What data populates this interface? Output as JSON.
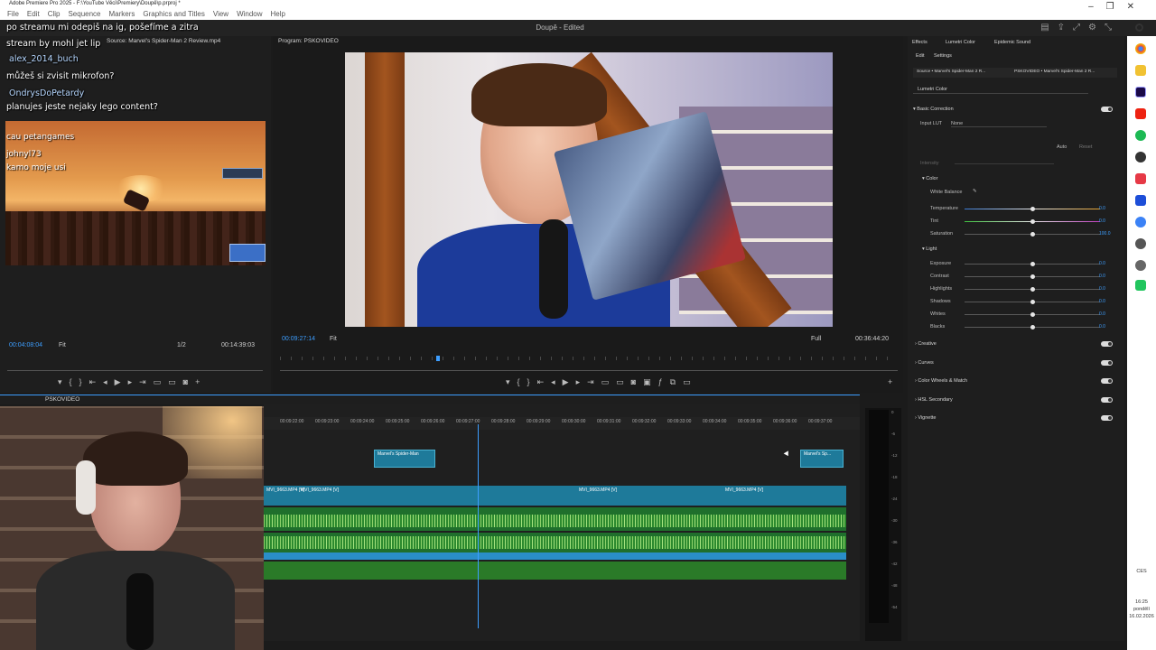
{
  "titlebar": {
    "title": "Adobe Premiere Pro 2025 - F:\\YouTube Věci\\Premiery\\Doupě\\p.prproj *",
    "menus": [
      "File",
      "Edit",
      "Clip",
      "Sequence",
      "Markers",
      "Graphics and Titles",
      "View",
      "Window",
      "Help"
    ]
  },
  "appbar": {
    "document_title": "Doupě - Edited"
  },
  "chat": {
    "messages": [
      {
        "text": "po streamu mi odepiš na ig, pošefíme a zitra"
      },
      {
        "text": "stream by mohl jet lip"
      },
      {
        "user": "alex_2014_buch",
        "text": "můžeš si zvisit mikrofon?"
      },
      {
        "user": "OndrysDoPetardy",
        "text": "planujes jeste nejaky lego content?"
      },
      {
        "text": "cau petangames"
      },
      {
        "user": "johnyl73",
        "text": "kamo moje usi"
      }
    ]
  },
  "source_monitor": {
    "tab": "Source: Marvel's Spider-Man 2 Review.mp4",
    "timecode": "00:04:08:04",
    "fit": "Fit",
    "ratio": "1/2",
    "duration": "00:14:39:03"
  },
  "program_monitor": {
    "tab": "Program: PSKOVIDEO",
    "timecode": "00:09:27:14",
    "fit": "Fit",
    "quality": "Full",
    "duration": "00:36:44:20"
  },
  "timeline": {
    "sequence_name": "PSKOVIDEO",
    "ruler": [
      "00:09:22:00",
      "00:09:23:00",
      "00:09:24:00",
      "00:09:25:00",
      "00:09:26:00",
      "00:09:27:00",
      "00:09:28:00",
      "00:09:29:00",
      "00:09:30:00",
      "00:09:31:00",
      "00:09:32:00",
      "00:09:33:00",
      "00:09:34:00",
      "00:09:35:00",
      "00:09:36:00",
      "00:09:37:00"
    ],
    "v2_clips": [
      "Marvel's Spider-Man",
      "Marvel's Sp..."
    ],
    "v1_clips": [
      "MVI_9663.MP4 [V]",
      "MVI_9663.MP4 [V]",
      "MVI_9663.MP4 [V]",
      "MVI_9663.MP4 [V]"
    ],
    "meter_ticks": [
      "0",
      "-6",
      "-12",
      "-18",
      "-24",
      "-30",
      "-36",
      "-42",
      "-48",
      "-54"
    ]
  },
  "lumetri": {
    "tabs": [
      "Effects",
      "Lumetri Color",
      "Epidemic Sound"
    ],
    "subtabs": [
      "Edit",
      "Settings"
    ],
    "source_tabs": [
      "Source • Marvel's Spider-Man 2 R...",
      "PSKOVIDEO • Marvel's Spider-Man 2 R..."
    ],
    "effect_select": "Lumetri Color",
    "basic_correction": "Basic Correction",
    "input_lut_label": "Input LUT",
    "input_lut_value": "None",
    "auto": "Auto",
    "reset": "Reset",
    "intensity": "Intensity",
    "color_label": "Color",
    "white_balance": "White Balance",
    "color_rows": [
      {
        "label": "Temperature",
        "value": "0.0",
        "pos": 0.5
      },
      {
        "label": "Tint",
        "value": "0.0",
        "pos": 0.5
      },
      {
        "label": "Saturation",
        "value": "100.0",
        "pos": 0.5
      }
    ],
    "light_label": "Light",
    "light_rows": [
      {
        "label": "Exposure",
        "value": "0.0",
        "pos": 0.5
      },
      {
        "label": "Contrast",
        "value": "0.0",
        "pos": 0.5
      },
      {
        "label": "Highlights",
        "value": "0.0",
        "pos": 0.5
      },
      {
        "label": "Shadows",
        "value": "0.0",
        "pos": 0.5
      },
      {
        "label": "Whites",
        "value": "0.0",
        "pos": 0.5
      },
      {
        "label": "Blacks",
        "value": "0.0",
        "pos": 0.5
      }
    ],
    "sections": [
      "Creative",
      "Curves",
      "Color Wheels & Match",
      "HSL Secondary",
      "Vignette"
    ]
  },
  "tray": {
    "lang": "CES",
    "time": "16:25",
    "day": "pondělí",
    "date": "16.02.2026"
  },
  "colors": {
    "accent": "#3d9eff",
    "video_clip": "#1e7a9a",
    "audio_clip": "#1f6f2c"
  }
}
